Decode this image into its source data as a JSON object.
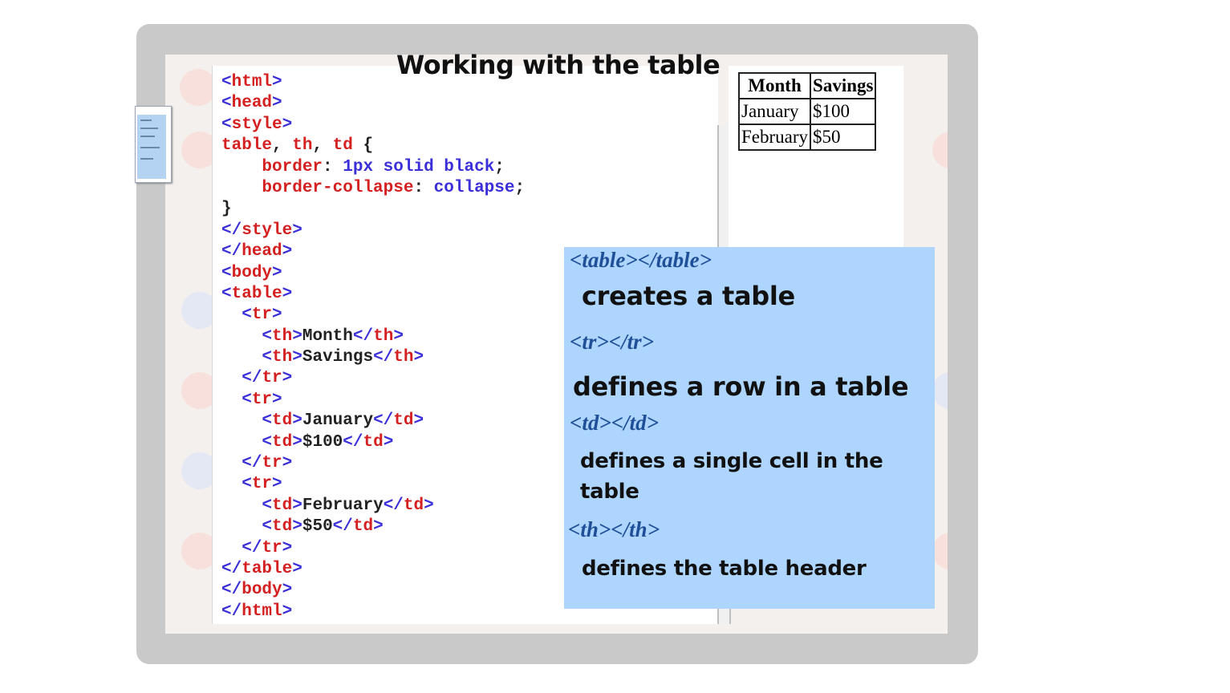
{
  "title": "Working with the table",
  "code_lines": [
    [
      {
        "t": "<",
        "c": "br"
      },
      {
        "t": "html",
        "c": "tag"
      },
      {
        "t": ">",
        "c": "br"
      }
    ],
    [
      {
        "t": "<",
        "c": "br"
      },
      {
        "t": "head",
        "c": "tag"
      },
      {
        "t": ">",
        "c": "br"
      }
    ],
    [
      {
        "t": "<",
        "c": "br"
      },
      {
        "t": "style",
        "c": "tag"
      },
      {
        "t": ">",
        "c": "br"
      }
    ],
    [
      {
        "t": "table",
        "c": "tag"
      },
      {
        "t": ", ",
        "c": "punc"
      },
      {
        "t": "th",
        "c": "tag"
      },
      {
        "t": ", ",
        "c": "punc"
      },
      {
        "t": "td",
        "c": "tag"
      },
      {
        "t": " {",
        "c": "punc"
      }
    ],
    [
      {
        "t": "    ",
        "c": "punc"
      },
      {
        "t": "border",
        "c": "tag"
      },
      {
        "t": ": ",
        "c": "punc"
      },
      {
        "t": "1px solid black",
        "c": "val"
      },
      {
        "t": ";",
        "c": "punc"
      }
    ],
    [
      {
        "t": "    ",
        "c": "punc"
      },
      {
        "t": "border-collapse",
        "c": "tag"
      },
      {
        "t": ": ",
        "c": "punc"
      },
      {
        "t": "collapse",
        "c": "val"
      },
      {
        "t": ";",
        "c": "punc"
      }
    ],
    [
      {
        "t": "}",
        "c": "punc"
      }
    ],
    [
      {
        "t": "</",
        "c": "br"
      },
      {
        "t": "style",
        "c": "tag"
      },
      {
        "t": ">",
        "c": "br"
      }
    ],
    [
      {
        "t": "</",
        "c": "br"
      },
      {
        "t": "head",
        "c": "tag"
      },
      {
        "t": ">",
        "c": "br"
      }
    ],
    [
      {
        "t": "<",
        "c": "br"
      },
      {
        "t": "body",
        "c": "tag"
      },
      {
        "t": ">",
        "c": "br"
      }
    ],
    [
      {
        "t": "<",
        "c": "br"
      },
      {
        "t": "table",
        "c": "tag"
      },
      {
        "t": ">",
        "c": "br"
      }
    ],
    [
      {
        "t": "  ",
        "c": "punc"
      },
      {
        "t": "<",
        "c": "br"
      },
      {
        "t": "tr",
        "c": "tag"
      },
      {
        "t": ">",
        "c": "br"
      }
    ],
    [
      {
        "t": "    ",
        "c": "punc"
      },
      {
        "t": "<",
        "c": "br"
      },
      {
        "t": "th",
        "c": "tag"
      },
      {
        "t": ">",
        "c": "br"
      },
      {
        "t": "Month",
        "c": "punc"
      },
      {
        "t": "</",
        "c": "br"
      },
      {
        "t": "th",
        "c": "tag"
      },
      {
        "t": ">",
        "c": "br"
      }
    ],
    [
      {
        "t": "    ",
        "c": "punc"
      },
      {
        "t": "<",
        "c": "br"
      },
      {
        "t": "th",
        "c": "tag"
      },
      {
        "t": ">",
        "c": "br"
      },
      {
        "t": "Savings",
        "c": "punc"
      },
      {
        "t": "</",
        "c": "br"
      },
      {
        "t": "th",
        "c": "tag"
      },
      {
        "t": ">",
        "c": "br"
      }
    ],
    [
      {
        "t": "  ",
        "c": "punc"
      },
      {
        "t": "</",
        "c": "br"
      },
      {
        "t": "tr",
        "c": "tag"
      },
      {
        "t": ">",
        "c": "br"
      }
    ],
    [
      {
        "t": "  ",
        "c": "punc"
      },
      {
        "t": "<",
        "c": "br"
      },
      {
        "t": "tr",
        "c": "tag"
      },
      {
        "t": ">",
        "c": "br"
      }
    ],
    [
      {
        "t": "    ",
        "c": "punc"
      },
      {
        "t": "<",
        "c": "br"
      },
      {
        "t": "td",
        "c": "tag"
      },
      {
        "t": ">",
        "c": "br"
      },
      {
        "t": "January",
        "c": "punc"
      },
      {
        "t": "</",
        "c": "br"
      },
      {
        "t": "td",
        "c": "tag"
      },
      {
        "t": ">",
        "c": "br"
      }
    ],
    [
      {
        "t": "    ",
        "c": "punc"
      },
      {
        "t": "<",
        "c": "br"
      },
      {
        "t": "td",
        "c": "tag"
      },
      {
        "t": ">",
        "c": "br"
      },
      {
        "t": "$100",
        "c": "punc"
      },
      {
        "t": "</",
        "c": "br"
      },
      {
        "t": "td",
        "c": "tag"
      },
      {
        "t": ">",
        "c": "br"
      }
    ],
    [
      {
        "t": "  ",
        "c": "punc"
      },
      {
        "t": "</",
        "c": "br"
      },
      {
        "t": "tr",
        "c": "tag"
      },
      {
        "t": ">",
        "c": "br"
      }
    ],
    [
      {
        "t": "  ",
        "c": "punc"
      },
      {
        "t": "<",
        "c": "br"
      },
      {
        "t": "tr",
        "c": "tag"
      },
      {
        "t": ">",
        "c": "br"
      }
    ],
    [
      {
        "t": "    ",
        "c": "punc"
      },
      {
        "t": "<",
        "c": "br"
      },
      {
        "t": "td",
        "c": "tag"
      },
      {
        "t": ">",
        "c": "br"
      },
      {
        "t": "February",
        "c": "punc"
      },
      {
        "t": "</",
        "c": "br"
      },
      {
        "t": "td",
        "c": "tag"
      },
      {
        "t": ">",
        "c": "br"
      }
    ],
    [
      {
        "t": "    ",
        "c": "punc"
      },
      {
        "t": "<",
        "c": "br"
      },
      {
        "t": "td",
        "c": "tag"
      },
      {
        "t": ">",
        "c": "br"
      },
      {
        "t": "$50",
        "c": "punc"
      },
      {
        "t": "</",
        "c": "br"
      },
      {
        "t": "td",
        "c": "tag"
      },
      {
        "t": ">",
        "c": "br"
      }
    ],
    [
      {
        "t": "  ",
        "c": "punc"
      },
      {
        "t": "</",
        "c": "br"
      },
      {
        "t": "tr",
        "c": "tag"
      },
      {
        "t": ">",
        "c": "br"
      }
    ],
    [
      {
        "t": "</",
        "c": "br"
      },
      {
        "t": "table",
        "c": "tag"
      },
      {
        "t": ">",
        "c": "br"
      }
    ],
    [
      {
        "t": "</",
        "c": "br"
      },
      {
        "t": "body",
        "c": "tag"
      },
      {
        "t": ">",
        "c": "br"
      }
    ],
    [
      {
        "t": "</",
        "c": "br"
      },
      {
        "t": "html",
        "c": "tag"
      },
      {
        "t": ">",
        "c": "br"
      }
    ]
  ],
  "output_table": {
    "headers": [
      "Month",
      "Savings"
    ],
    "rows": [
      [
        "January",
        "$100"
      ],
      [
        "February",
        "$50"
      ]
    ]
  },
  "notes": {
    "table_tag": "<table></table>",
    "table_desc": "creates a table",
    "tr_tag": "<tr></tr>",
    "tr_desc": "defines a row in a table",
    "td_tag": "<td></td>",
    "td_desc_1": "defines a single cell in the",
    "td_desc_2": "table",
    "th_tag": "<th></th>",
    "th_desc": "defines the table header"
  },
  "colors": {
    "tag": "#d42020",
    "bracket": "#3a2fd8",
    "note_bg": "#aed5fe",
    "note_tag": "#1f4f97"
  }
}
